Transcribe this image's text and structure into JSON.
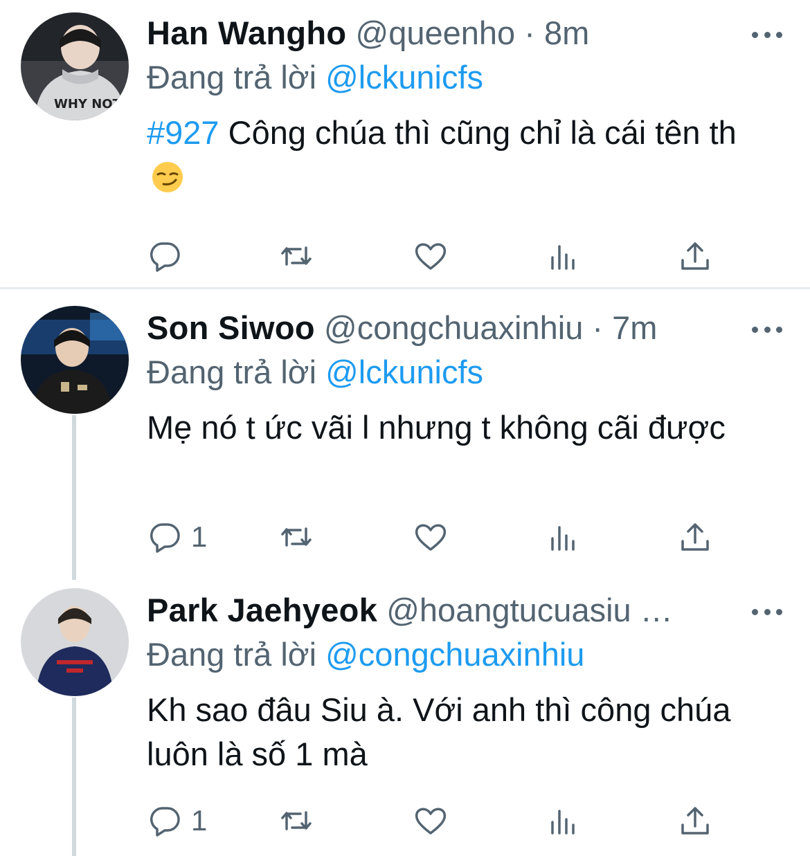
{
  "tweets": [
    {
      "name": "Han Wangho",
      "handle": "@queenho",
      "separator": "·",
      "time": "8m",
      "reply_prefix": "Đang trả lời",
      "reply_to": "@lckunicfs",
      "hashtag": "#927",
      "text": " Công chúa thì cũng chỉ là cái tên th",
      "emoji": "smirking-face",
      "reply_count": ""
    },
    {
      "name": "Son Siwoo",
      "handle": "@congchuaxinhiu",
      "separator": "·",
      "time": "7m",
      "reply_prefix": "Đang trả lời",
      "reply_to": "@lckunicfs",
      "text": "Mẹ nó t ức vãi l nhưng t không cãi được",
      "reply_count": "1"
    },
    {
      "name": "Park Jaehyeok",
      "handle": "@hoangtucuasiu …",
      "reply_prefix": "Đang trả lời",
      "reply_to": "@congchuaxinhiu",
      "text": "Kh sao đâu Siu à. Với anh thì công chúa luôn là số 1 mà",
      "reply_count": "1"
    }
  ],
  "icons": {
    "reply": "reply-icon",
    "retweet": "retweet-icon",
    "like": "heart-icon",
    "views": "views-icon",
    "share": "share-icon",
    "more": "more-icon"
  },
  "colors": {
    "link": "#1d9bf0",
    "secondary_text": "#536471",
    "primary_text": "#0f1419",
    "divider": "#e8ecef",
    "thread_line": "#cfd9de"
  }
}
